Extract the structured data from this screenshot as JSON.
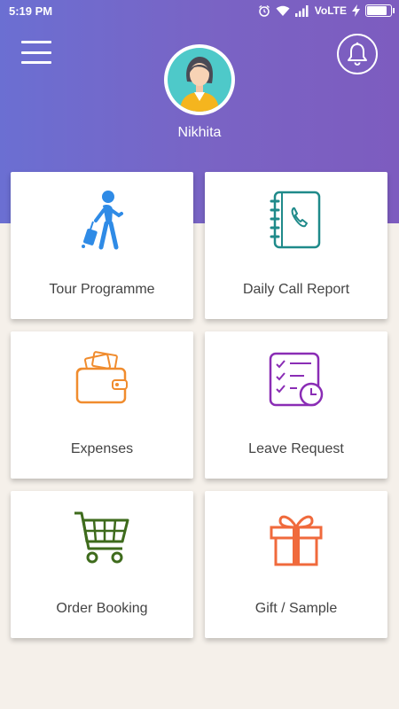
{
  "status_bar": {
    "time": "5:19 PM",
    "network": "VoLTE",
    "icons": [
      "alarm-icon",
      "wifi-icon",
      "signal-icon",
      "charging-icon",
      "battery-icon"
    ]
  },
  "header": {
    "menu_icon": "hamburger-menu-icon",
    "notification_icon": "bell-icon",
    "user_name": "Nikhita",
    "colors": {
      "gradient_start": "#6b6fd2",
      "gradient_end": "#7d5cbf"
    }
  },
  "tiles": [
    {
      "label": "Tour Programme",
      "icon": "walking-traveler-icon",
      "color": "#2f8be6"
    },
    {
      "label": "Daily Call Report",
      "icon": "phone-book-icon",
      "color": "#1f8a8a"
    },
    {
      "label": "Expenses",
      "icon": "wallet-icon",
      "color": "#f08c2e"
    },
    {
      "label": "Leave Request",
      "icon": "checklist-clock-icon",
      "color": "#8a2db5"
    },
    {
      "label": "Order Booking",
      "icon": "shopping-cart-icon",
      "color": "#3e6b1c"
    },
    {
      "label": "Gift / Sample",
      "icon": "gift-icon",
      "color": "#f06a3c"
    }
  ]
}
